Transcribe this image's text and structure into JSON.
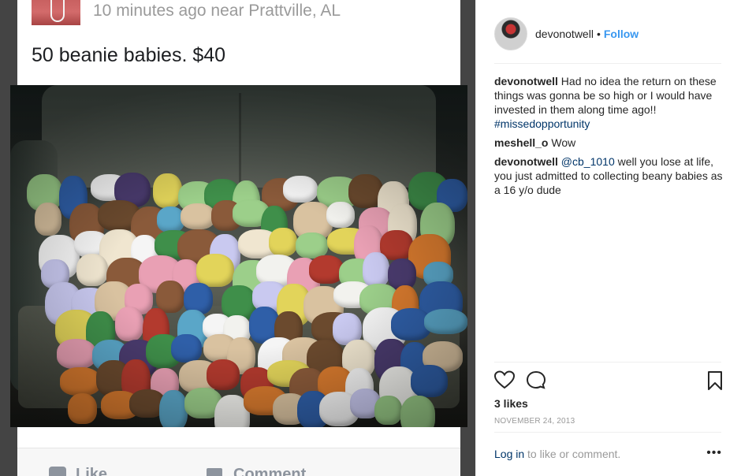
{
  "post": {
    "meta": "10 minutes ago near Prattville, AL",
    "title": "50 beanie babies.  $40",
    "like_label": "Like",
    "comment_label": "Comment"
  },
  "panel": {
    "username": "devonotwell",
    "separator": "•",
    "follow_label": "Follow",
    "comments": [
      {
        "user": "devonotwell",
        "text": "Had no idea the return on these things was gonna be so high or I would have invested in them along time ago!!",
        "hashtag": "#missedopportunity"
      },
      {
        "user": "meshell_o",
        "text": "Wow"
      },
      {
        "user": "devonotwell",
        "mention": "@cb_1010",
        "text": "well you lose at life, you just admitted to collecting beany babies as a 16 y/o dude"
      }
    ],
    "likes": "3 likes",
    "date": "NOVEMBER 24, 2013",
    "login_link": "Log in",
    "login_text": "to like or comment.",
    "more": "•••"
  },
  "icons": {
    "heart": "heart-icon",
    "comment": "comment-bubble-icon",
    "bookmark": "bookmark-icon"
  },
  "colors": {
    "follow": "#3897f0",
    "link": "#003569",
    "muted": "#999999",
    "text": "#262626"
  }
}
